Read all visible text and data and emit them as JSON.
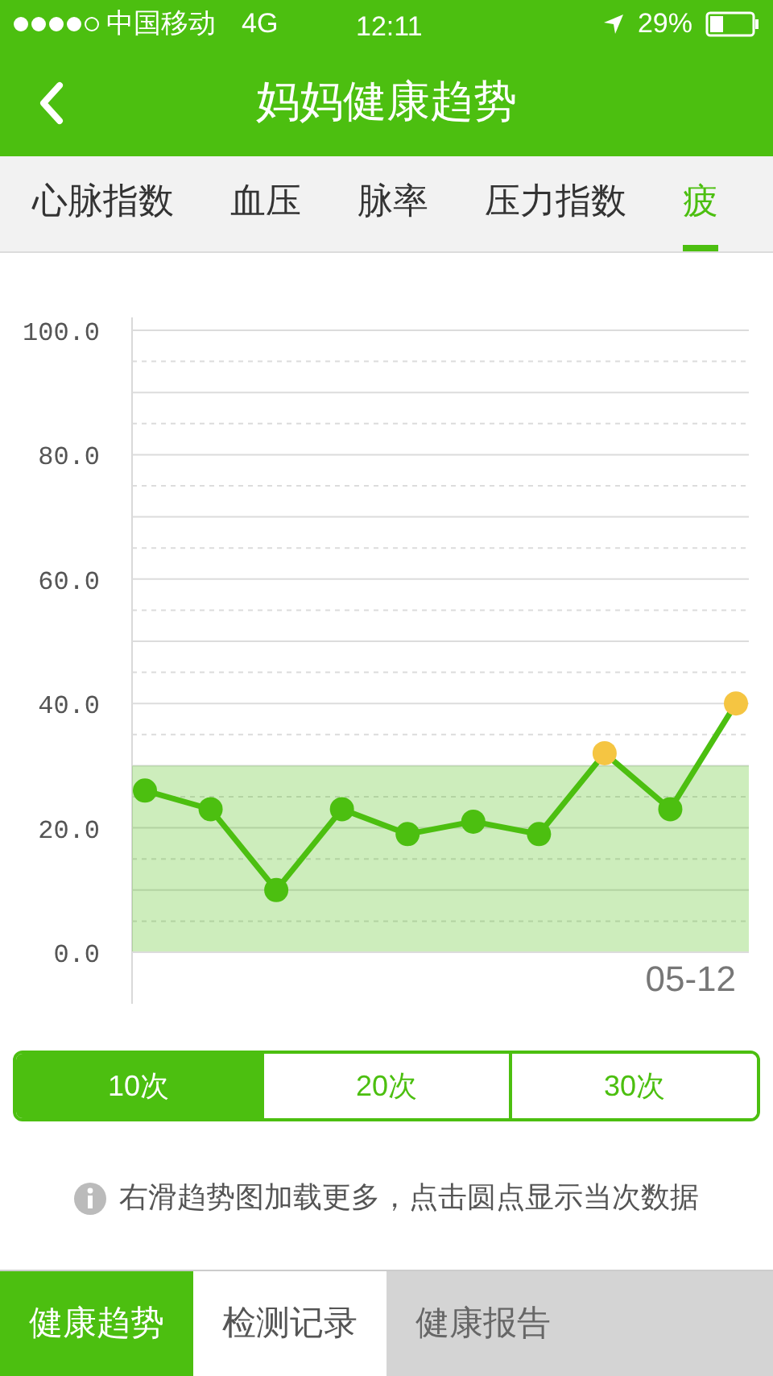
{
  "status_bar": {
    "carrier": "中国移动",
    "network": "4G",
    "time": "12:11",
    "battery": "29%"
  },
  "header": {
    "title": "妈妈健康趋势"
  },
  "tabs": [
    {
      "label": "心脉指数",
      "selected": false
    },
    {
      "label": "血压",
      "selected": false
    },
    {
      "label": "脉率",
      "selected": false
    },
    {
      "label": "压力指数",
      "selected": false
    },
    {
      "label": "疲",
      "selected": true
    }
  ],
  "chart": {
    "chart_data": {
      "type": "line",
      "ylim": [
        0,
        100
      ],
      "yticks": [
        {
          "value": 0,
          "label": "0.0"
        },
        {
          "value": 20,
          "label": "20.0"
        },
        {
          "value": 40,
          "label": "40.0"
        },
        {
          "value": 60,
          "label": "60.0"
        },
        {
          "value": 80,
          "label": "80.0"
        },
        {
          "value": 100,
          "label": "100.0"
        }
      ],
      "grid": true,
      "series": [
        {
          "color": "#4cbf10",
          "marker": true,
          "values": [
            26,
            23,
            10,
            23,
            19,
            21,
            19,
            32,
            23,
            40
          ]
        }
      ],
      "bands": [
        {
          "axis": "y",
          "from": 0,
          "to": 30
        }
      ]
    },
    "date_label": "05-12"
  },
  "range_selector": [
    {
      "label": "10次",
      "selected": true
    },
    {
      "label": "20次",
      "selected": false
    },
    {
      "label": "30次",
      "selected": false
    }
  ],
  "hint": "右滑趋势图加载更多，点击圆点显示当次数据",
  "bottom_tabs": [
    {
      "label": "健康趋势",
      "selected": true
    },
    {
      "label": "检测记录",
      "selected": false
    },
    {
      "label": "健康报告",
      "selected": false
    }
  ]
}
